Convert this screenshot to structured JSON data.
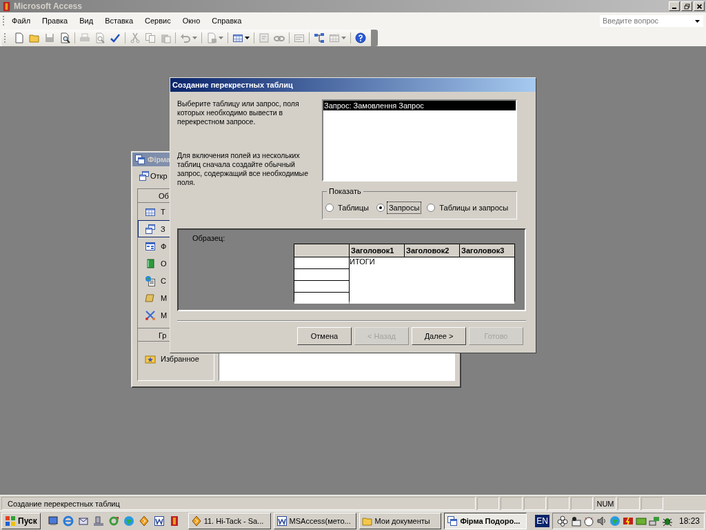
{
  "window": {
    "title": "Microsoft Access"
  },
  "menu": [
    "Файл",
    "Правка",
    "Вид",
    "Вставка",
    "Сервис",
    "Окно",
    "Справка"
  ],
  "help_search": {
    "placeholder": "Введите вопрос"
  },
  "toolbar": [
    {
      "kind": "new",
      "disabled": false
    },
    {
      "kind": "open",
      "disabled": false
    },
    {
      "kind": "save",
      "disabled": true
    },
    {
      "kind": "file_search",
      "disabled": false
    },
    {
      "kind": "separator"
    },
    {
      "kind": "print",
      "disabled": true
    },
    {
      "kind": "preview",
      "disabled": true
    },
    {
      "kind": "spelling",
      "disabled": false
    },
    {
      "kind": "separator"
    },
    {
      "kind": "cut",
      "disabled": true
    },
    {
      "kind": "copy",
      "disabled": true
    },
    {
      "kind": "paste",
      "disabled": true
    },
    {
      "kind": "separator"
    },
    {
      "kind": "undo",
      "disabled": true,
      "menu": true
    },
    {
      "kind": "separator"
    },
    {
      "kind": "office_links",
      "disabled": true,
      "menu": true
    },
    {
      "kind": "separator"
    },
    {
      "kind": "analyze",
      "disabled": false,
      "menu": true
    },
    {
      "kind": "separator"
    },
    {
      "kind": "code",
      "disabled": true
    },
    {
      "kind": "script",
      "disabled": true
    },
    {
      "kind": "separator"
    },
    {
      "kind": "properties",
      "disabled": true
    },
    {
      "kind": "separator"
    },
    {
      "kind": "relationships",
      "disabled": false
    },
    {
      "kind": "new_object",
      "disabled": true,
      "menu": true
    },
    {
      "kind": "separator"
    },
    {
      "kind": "help",
      "disabled": false
    }
  ],
  "db_window": {
    "title": "Фірма",
    "open_button": "Откр",
    "objects_header": "Об",
    "objects": [
      {
        "kind": "table",
        "label": "Т",
        "selected": false
      },
      {
        "kind": "query",
        "label": "З",
        "selected": true
      },
      {
        "kind": "form",
        "label": "Ф",
        "selected": false
      },
      {
        "kind": "report",
        "label": "О",
        "selected": false
      },
      {
        "kind": "page",
        "label": "С",
        "selected": false
      },
      {
        "kind": "macro",
        "label": "М",
        "selected": false
      },
      {
        "kind": "module",
        "label": "М",
        "selected": false
      }
    ],
    "groups_header": "Гр",
    "groups": [
      {
        "kind": "favorites",
        "label": "Избранное"
      }
    ]
  },
  "dialog": {
    "title": "Создание перекрестных таблиц",
    "instruction": "Выберите таблицу или запрос, поля которых необходимо вывести в перекрестном запросе.",
    "hint": "Для включения полей из нескольких таблиц сначала создайте обычный запрос, содержащий все необходимые поля.",
    "sources": [
      {
        "label": "Запрос: Замовлення Запрос",
        "selected": true
      }
    ],
    "show": {
      "legend": "Показать",
      "options": [
        {
          "label": "Таблицы",
          "selected": false,
          "focused": false
        },
        {
          "label": "Запросы",
          "selected": true,
          "focused": true
        },
        {
          "label": "Таблицы и запросы",
          "selected": false,
          "focused": false
        }
      ]
    },
    "sample": {
      "label": "Образец:",
      "headings": [
        "Заголовок1",
        "Заголовок2",
        "Заголовок3"
      ],
      "value_label": "ИТОГИ"
    },
    "buttons": [
      {
        "label": "Отмена",
        "disabled": false
      },
      {
        "label": "< Назад",
        "disabled": true
      },
      {
        "label": "Далее >",
        "disabled": false
      },
      {
        "label": "Готово",
        "disabled": true
      }
    ]
  },
  "status_bar": {
    "text": "Создание перекрестных таблиц",
    "indicator": "NUM"
  },
  "taskbar": {
    "start": "Пуск",
    "quick_launch": [
      {
        "kind": "desktop"
      },
      {
        "kind": "browser"
      },
      {
        "kind": "outlook"
      },
      {
        "kind": "disk"
      },
      {
        "kind": "sync"
      },
      {
        "kind": "globe"
      },
      {
        "kind": "player"
      },
      {
        "kind": "word"
      },
      {
        "kind": "media"
      }
    ],
    "tasks": [
      {
        "kind": "player",
        "label": "11. Hi-Tack - Sa...",
        "selected": false
      },
      {
        "kind": "word",
        "label": "MSAccess(мето...",
        "selected": false
      },
      {
        "kind": "folder",
        "label": "Мои документы",
        "selected": false
      },
      {
        "kind": "access",
        "label": "Фірма Подоро...",
        "selected": true
      }
    ],
    "language": "EN",
    "tray": [
      {
        "kind": "flower"
      },
      {
        "kind": "mail"
      },
      {
        "kind": "animal"
      },
      {
        "kind": "speaker"
      },
      {
        "kind": "globe"
      },
      {
        "kind": "flash"
      },
      {
        "kind": "card"
      },
      {
        "kind": "network"
      },
      {
        "kind": "bug"
      }
    ],
    "clock": "18:23"
  }
}
